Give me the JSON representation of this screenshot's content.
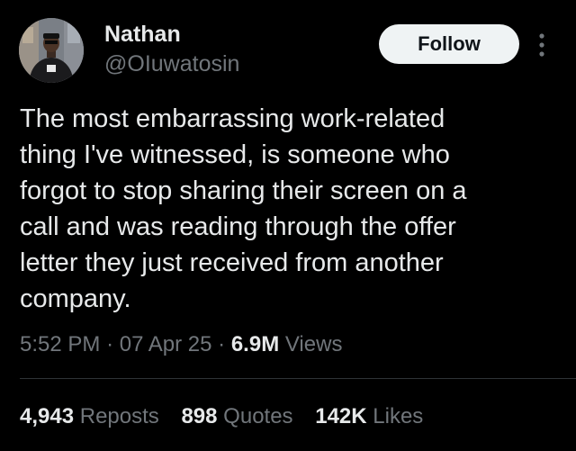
{
  "author": {
    "name": "Nathan",
    "handle": "@OIuwatosin"
  },
  "actions": {
    "follow_label": "Follow"
  },
  "icons": {
    "more": "more-vertical-icon"
  },
  "tweet": {
    "text": "The most embarrassing work-related\nthing I've witnessed, is someone who\nforgot to stop sharing their screen on a\ncall and was reading through the offer\nletter they just received from another\ncompany."
  },
  "meta": {
    "time": "5:52 PM",
    "date": "07 Apr 25",
    "views_count": "6.9M",
    "views_label": "Views",
    "separator": "·"
  },
  "stats": {
    "reposts_count": "4,943",
    "reposts_label": "Reposts",
    "quotes_count": "898",
    "quotes_label": "Quotes",
    "likes_count": "142K",
    "likes_label": "Likes"
  },
  "colors": {
    "background": "#000000",
    "primary_text": "#e7e9ea",
    "secondary_text": "#71767b",
    "button_bg": "#eff3f4",
    "divider": "#2f3336"
  }
}
